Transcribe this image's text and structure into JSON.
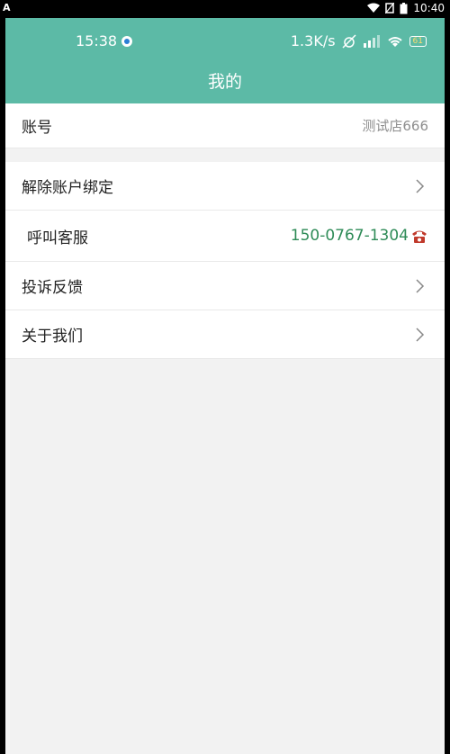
{
  "system_bar": {
    "indicator": "A",
    "time": "10:40"
  },
  "inner_status": {
    "time": "15:38",
    "speed": "1.3K/s",
    "battery_label": "61"
  },
  "header": {
    "title": "我的"
  },
  "account": {
    "label": "账号",
    "value": "测试店666"
  },
  "menu": {
    "unbind_label": "解除账户绑定",
    "service_label": "呼叫客服",
    "service_phone": "150-0767-1304",
    "feedback_label": "投诉反馈",
    "about_label": "关于我们"
  },
  "colors": {
    "accent": "#5cbaa6",
    "phone": "#2e8b57"
  }
}
